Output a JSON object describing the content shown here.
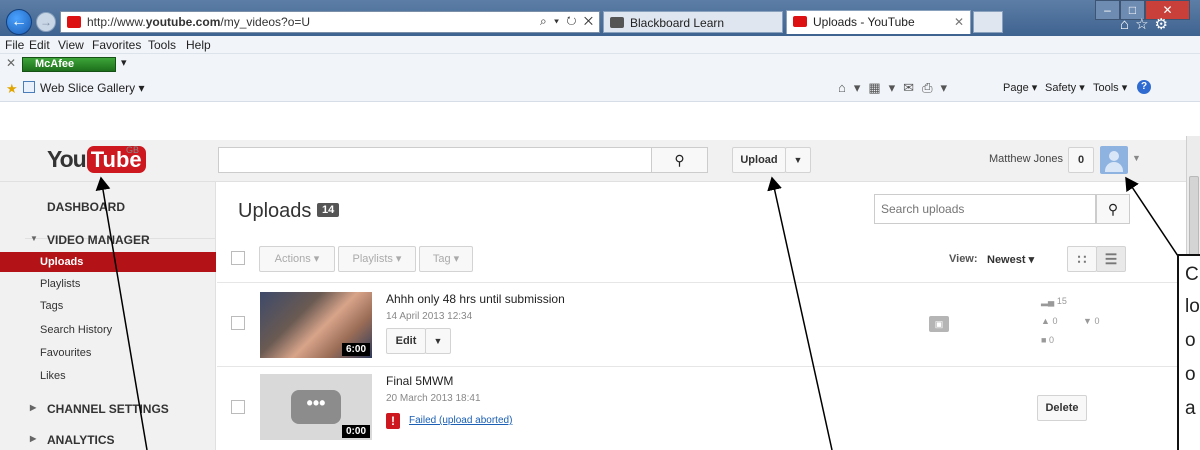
{
  "browser": {
    "url_prefix": "http://www.",
    "url_domain": "youtube.com",
    "url_path": "/my_videos?o=U",
    "address_icons": "⌕ ▾ ↻ ✕",
    "tabs": [
      {
        "label": "Blackboard Learn",
        "active": false
      },
      {
        "label": "Uploads - YouTube",
        "active": true
      }
    ],
    "menu": [
      "File",
      "Edit",
      "View",
      "Favorites",
      "Tools",
      "Help"
    ],
    "mcafee_label": "McAfee",
    "web_slice": "Web Slice Gallery ▾",
    "command_items": [
      "Page ▾",
      "Safety ▾",
      "Tools ▾"
    ]
  },
  "youtube": {
    "logo_you": "You",
    "logo_tube": "Tube",
    "logo_region": "GB",
    "search_placeholder": "",
    "upload_label": "Upload",
    "user_name": "Matthew Jones",
    "notification_count": "0"
  },
  "sidebar": {
    "dashboard": "DASHBOARD",
    "video_manager": "VIDEO MANAGER",
    "items": [
      "Uploads",
      "Playlists",
      "Tags",
      "Search History",
      "Favourites",
      "Likes"
    ],
    "channel_settings": "CHANNEL SETTINGS",
    "analytics": "ANALYTICS"
  },
  "main": {
    "title": "Uploads",
    "count": "14",
    "search_placeholder": "Search uploads",
    "actions_label": "Actions",
    "playlists_label": "Playlists",
    "tag_label": "Tag",
    "view_label": "View:",
    "sort_label": "Newest"
  },
  "videos": [
    {
      "title": "Ahhh only 48 hrs until submission",
      "date": "14 April 2013 12:34",
      "duration": "6:00",
      "edit_label": "Edit",
      "views": "15",
      "likes": "0",
      "dislikes": "0",
      "comments": "0"
    },
    {
      "title": "Final 5MWM",
      "date": "20 March 2013 18:41",
      "duration": "0:00",
      "status": "Failed (upload aborted)",
      "delete_label": "Delete"
    }
  ],
  "annotation": {
    "letters": [
      "C",
      "lo",
      "o",
      "o",
      "a"
    ]
  },
  "colors": {
    "brand_red": "#cc181e",
    "sidebar_active": "#b31217",
    "link_blue": "#1a5fb4"
  }
}
